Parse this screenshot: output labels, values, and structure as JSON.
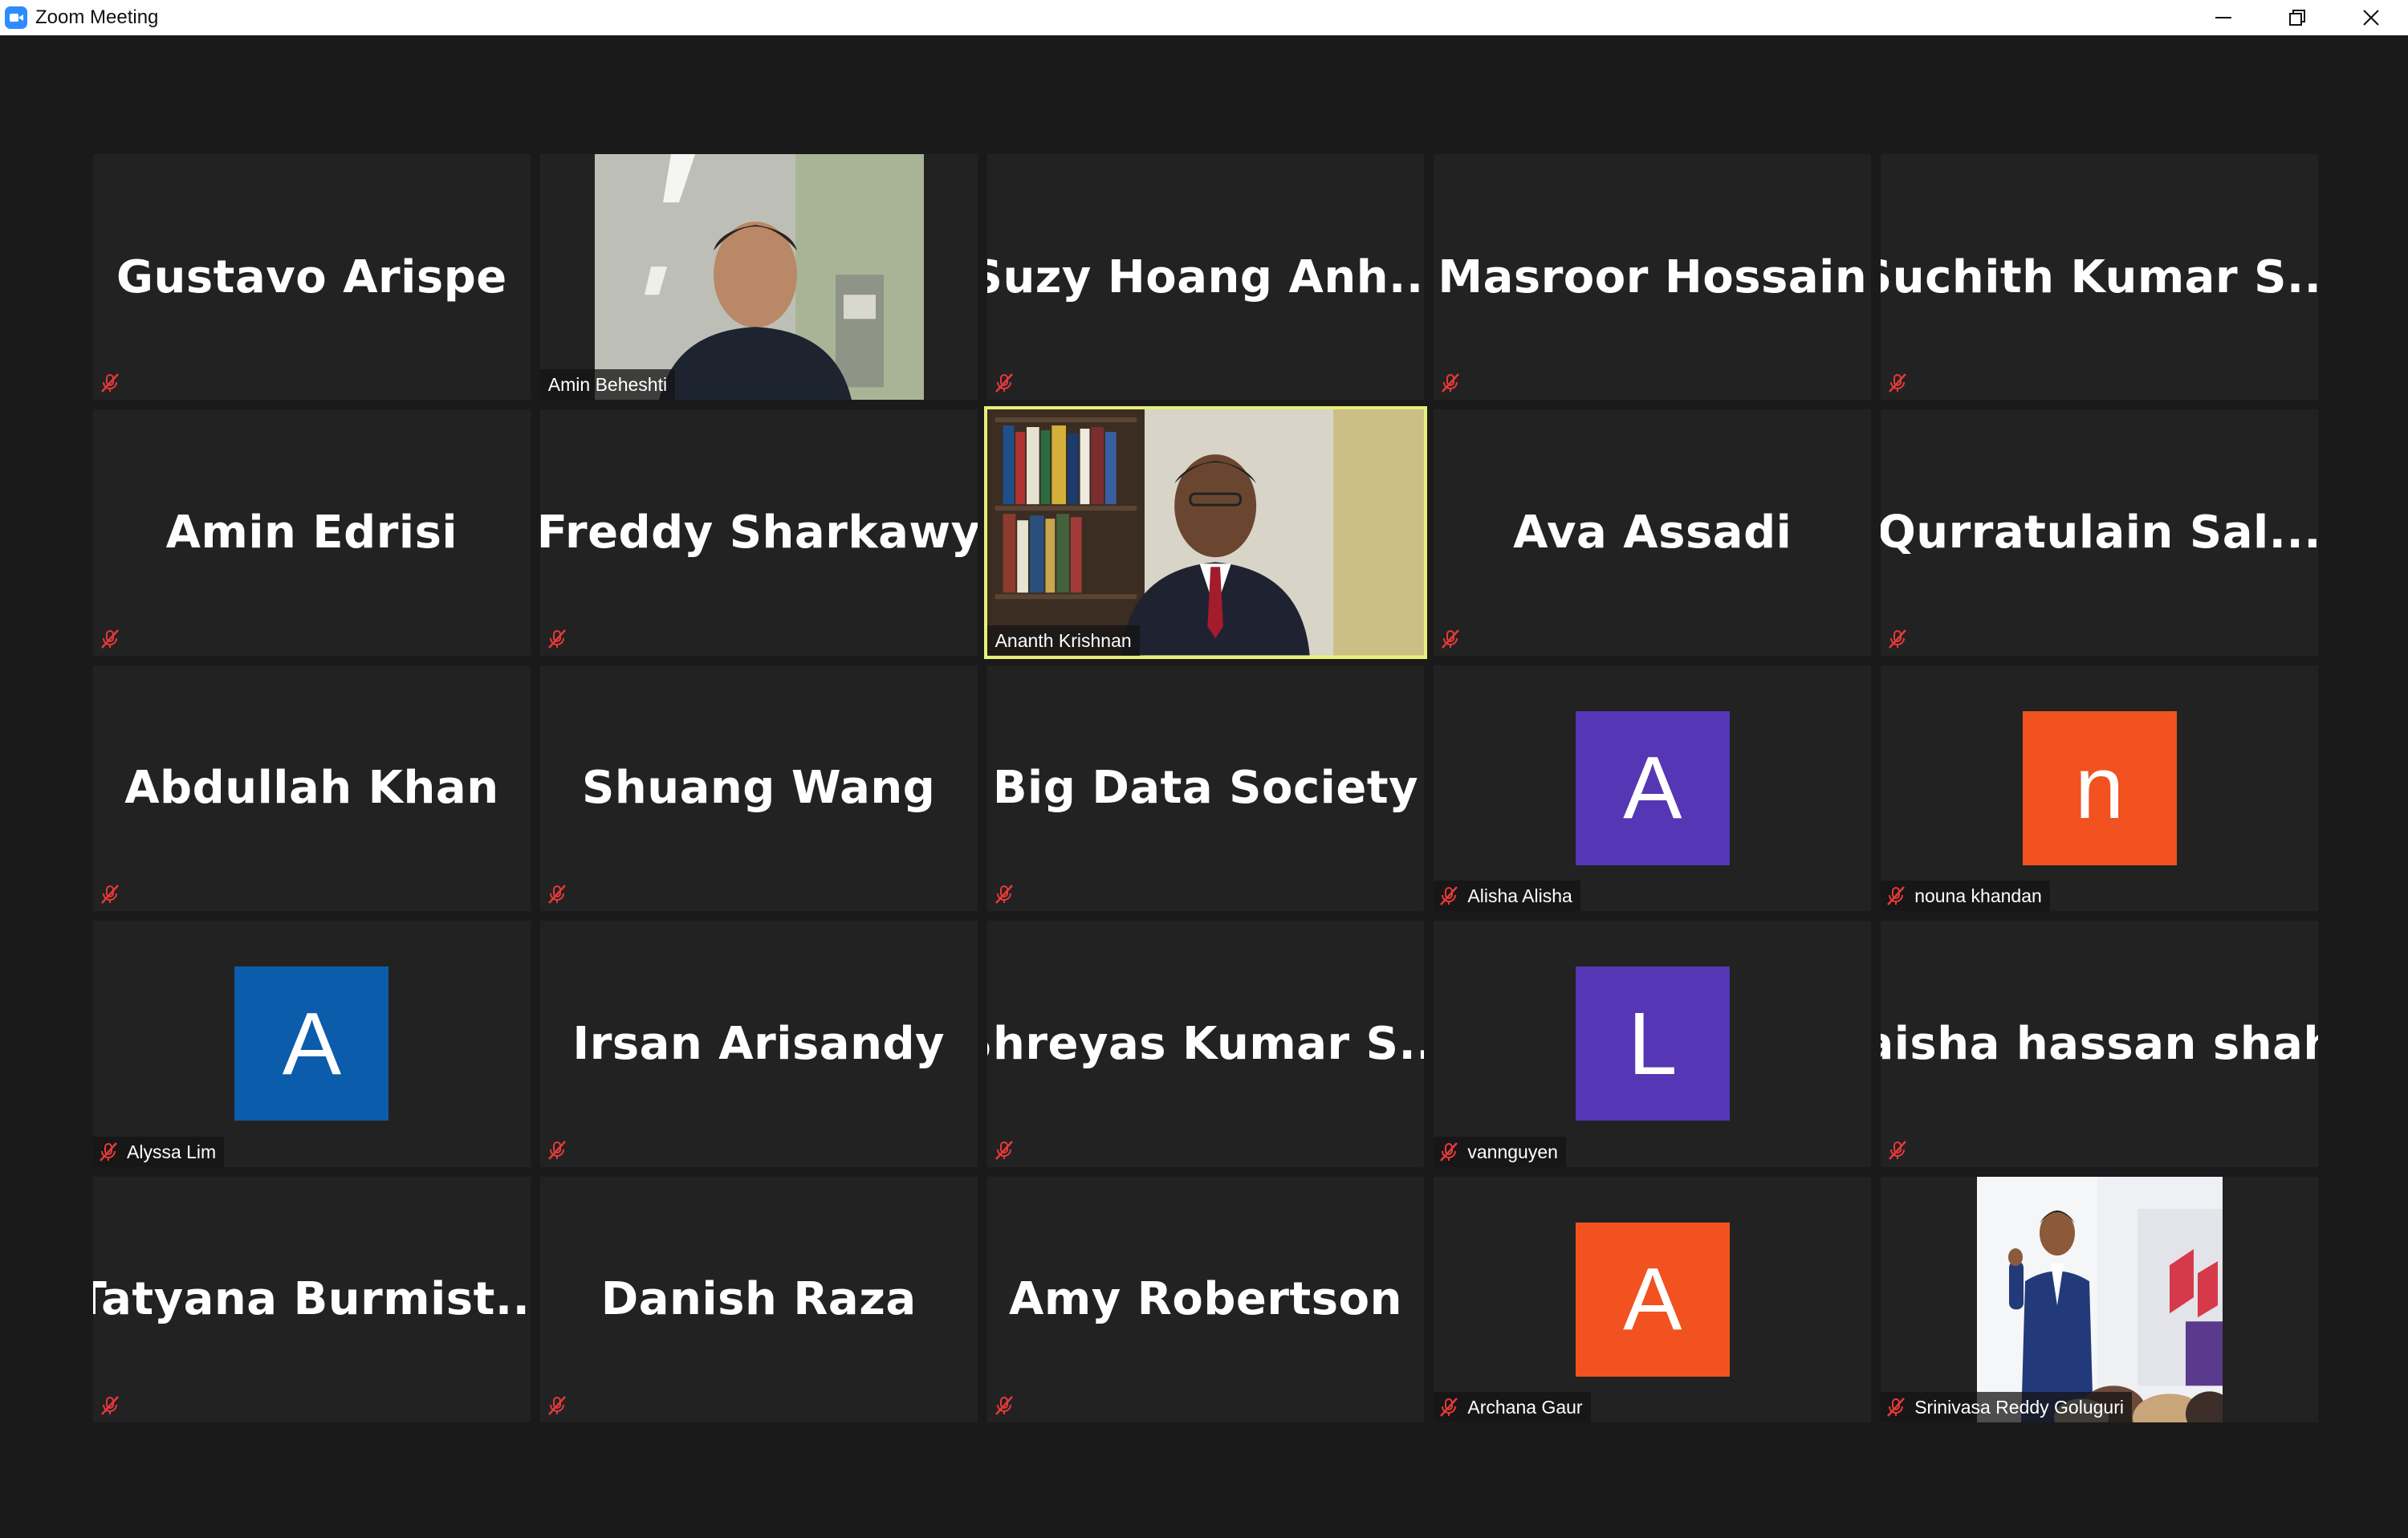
{
  "window": {
    "title": "Zoom Meeting"
  },
  "colors": {
    "avatar_purple": "#5536b4",
    "avatar_orange": "#f15220",
    "avatar_blue": "#0b5cab",
    "active_speaker_border": "#e6f07a",
    "mute_red": "#e5393b"
  },
  "participants": [
    {
      "name": "Gustavo Arispe"
    },
    {
      "name": "Amin Beheshti"
    },
    {
      "name": "Suzy  Hoang  Anh..."
    },
    {
      "name": "Masroor Hossain"
    },
    {
      "name": "Suchith  Kumar  S..."
    },
    {
      "name": "Amin Edrisi"
    },
    {
      "name": "Freddy Sharkawy"
    },
    {
      "name": "Ananth Krishnan"
    },
    {
      "name": "Ava Assadi"
    },
    {
      "name": "Qurratulain  Sal..."
    },
    {
      "name": "Abdullah Khan"
    },
    {
      "name": "Shuang Wang"
    },
    {
      "name": "Big Data Society"
    },
    {
      "name": "Alisha Alisha",
      "initial": "A"
    },
    {
      "name": "nouna khandan",
      "initial": "n"
    },
    {
      "name": "Alyssa Lim",
      "initial": "A"
    },
    {
      "name": "Irsan Arisandy"
    },
    {
      "name": "Shreyas  Kumar  S..."
    },
    {
      "name": "vannguyen",
      "initial": "L"
    },
    {
      "name": "aisha hassan shah"
    },
    {
      "name": "Tatyana  Burmist..."
    },
    {
      "name": "Danish Raza"
    },
    {
      "name": "Amy Robertson"
    },
    {
      "name": "Archana Gaur",
      "initial": "A"
    },
    {
      "name": "Srinivasa Reddy Goluguri"
    }
  ]
}
